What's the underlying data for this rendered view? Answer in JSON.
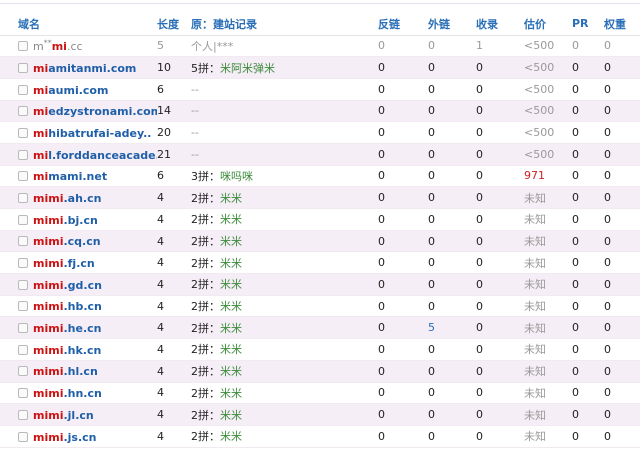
{
  "headers": {
    "name": "域名",
    "length": "长度",
    "original": "原：建站记录",
    "backlinks": "反链",
    "outlinks": "外链",
    "indexed": "收录",
    "valuation": "估价",
    "pr": "PR",
    "weight": "权重"
  },
  "rows": [
    {
      "pre": "m",
      "sup": "**",
      "hl": "mi",
      "post": ".cc",
      "len": "5",
      "orig_prefix": "",
      "orig_value": "个人|***",
      "back": "0",
      "out": "0",
      "idx": "1",
      "val": "<500",
      "pr": "0",
      "wt": "0",
      "style": "dim"
    },
    {
      "pre": "",
      "sup": "",
      "hl": "mi",
      "post": "amitanmi.com",
      "len": "10",
      "orig_prefix": "5拼：",
      "orig_value": "米阿米弹米",
      "back": "0",
      "out": "0",
      "idx": "0",
      "val": "<500",
      "pr": "0",
      "wt": "0",
      "style": "normal"
    },
    {
      "pre": "",
      "sup": "",
      "hl": "mi",
      "post": "aumi.com",
      "len": "6",
      "orig_prefix": "",
      "orig_value": "--",
      "back": "0",
      "out": "0",
      "idx": "0",
      "val": "<500",
      "pr": "0",
      "wt": "0",
      "style": "normal"
    },
    {
      "pre": "",
      "sup": "",
      "hl": "mi",
      "post": "edzystronami.com",
      "len": "14",
      "orig_prefix": "",
      "orig_value": "--",
      "back": "0",
      "out": "0",
      "idx": "0",
      "val": "<500",
      "pr": "0",
      "wt": "0",
      "style": "normal"
    },
    {
      "pre": "",
      "sup": "",
      "hl": "mi",
      "post": "hibatrufai-adey..",
      "len": "20",
      "orig_prefix": "",
      "orig_value": "--",
      "back": "0",
      "out": "0",
      "idx": "0",
      "val": "<500",
      "pr": "0",
      "wt": "0",
      "style": "normal"
    },
    {
      "pre": "",
      "sup": "",
      "hl": "mi",
      "post": "l.forddanceacade..",
      "len": "21",
      "orig_prefix": "",
      "orig_value": "--",
      "back": "0",
      "out": "0",
      "idx": "0",
      "val": "<500",
      "pr": "0",
      "wt": "0",
      "style": "normal"
    },
    {
      "pre": "",
      "sup": "",
      "hl": "mi",
      "post": "mami.net",
      "len": "6",
      "orig_prefix": "3拼：",
      "orig_value": "咪吗咪",
      "back": "0",
      "out": "0",
      "idx": "0",
      "val": "971",
      "pr": "0",
      "wt": "0",
      "style": "normal",
      "val_red": true
    },
    {
      "pre": "",
      "sup": "",
      "hl": "mimi",
      "post": ".ah.cn",
      "len": "4",
      "orig_prefix": "2拼：",
      "orig_value": "米米",
      "back": "0",
      "out": "0",
      "idx": "0",
      "val": "未知",
      "pr": "0",
      "wt": "0",
      "style": "normal"
    },
    {
      "pre": "",
      "sup": "",
      "hl": "mimi",
      "post": ".bj.cn",
      "len": "4",
      "orig_prefix": "2拼：",
      "orig_value": "米米",
      "back": "0",
      "out": "0",
      "idx": "0",
      "val": "未知",
      "pr": "0",
      "wt": "0",
      "style": "normal"
    },
    {
      "pre": "",
      "sup": "",
      "hl": "mimi",
      "post": ".cq.cn",
      "len": "4",
      "orig_prefix": "2拼：",
      "orig_value": "米米",
      "back": "0",
      "out": "0",
      "idx": "0",
      "val": "未知",
      "pr": "0",
      "wt": "0",
      "style": "normal"
    },
    {
      "pre": "",
      "sup": "",
      "hl": "mimi",
      "post": ".fj.cn",
      "len": "4",
      "orig_prefix": "2拼：",
      "orig_value": "米米",
      "back": "0",
      "out": "0",
      "idx": "0",
      "val": "未知",
      "pr": "0",
      "wt": "0",
      "style": "normal"
    },
    {
      "pre": "",
      "sup": "",
      "hl": "mimi",
      "post": ".gd.cn",
      "len": "4",
      "orig_prefix": "2拼：",
      "orig_value": "米米",
      "back": "0",
      "out": "0",
      "idx": "0",
      "val": "未知",
      "pr": "0",
      "wt": "0",
      "style": "normal"
    },
    {
      "pre": "",
      "sup": "",
      "hl": "mimi",
      "post": ".hb.cn",
      "len": "4",
      "orig_prefix": "2拼：",
      "orig_value": "米米",
      "back": "0",
      "out": "0",
      "idx": "0",
      "val": "未知",
      "pr": "0",
      "wt": "0",
      "style": "normal"
    },
    {
      "pre": "",
      "sup": "",
      "hl": "mimi",
      "post": ".he.cn",
      "len": "4",
      "orig_prefix": "2拼：",
      "orig_value": "米米",
      "back": "0",
      "out": "5",
      "idx": "0",
      "val": "未知",
      "pr": "0",
      "wt": "0",
      "style": "normal",
      "out_blue": true
    },
    {
      "pre": "",
      "sup": "",
      "hl": "mimi",
      "post": ".hk.cn",
      "len": "4",
      "orig_prefix": "2拼：",
      "orig_value": "米米",
      "back": "0",
      "out": "0",
      "idx": "0",
      "val": "未知",
      "pr": "0",
      "wt": "0",
      "style": "normal"
    },
    {
      "pre": "",
      "sup": "",
      "hl": "mimi",
      "post": ".hl.cn",
      "len": "4",
      "orig_prefix": "2拼：",
      "orig_value": "米米",
      "back": "0",
      "out": "0",
      "idx": "0",
      "val": "未知",
      "pr": "0",
      "wt": "0",
      "style": "normal"
    },
    {
      "pre": "",
      "sup": "",
      "hl": "mimi",
      "post": ".hn.cn",
      "len": "4",
      "orig_prefix": "2拼：",
      "orig_value": "米米",
      "back": "0",
      "out": "0",
      "idx": "0",
      "val": "未知",
      "pr": "0",
      "wt": "0",
      "style": "normal"
    },
    {
      "pre": "",
      "sup": "",
      "hl": "mimi",
      "post": ".jl.cn",
      "len": "4",
      "orig_prefix": "2拼：",
      "orig_value": "米米",
      "back": "0",
      "out": "0",
      "idx": "0",
      "val": "未知",
      "pr": "0",
      "wt": "0",
      "style": "normal"
    },
    {
      "pre": "",
      "sup": "",
      "hl": "mimi",
      "post": ".js.cn",
      "len": "4",
      "orig_prefix": "2拼：",
      "orig_value": "米米",
      "back": "0",
      "out": "0",
      "idx": "0",
      "val": "未知",
      "pr": "0",
      "wt": "0",
      "style": "normal"
    }
  ]
}
